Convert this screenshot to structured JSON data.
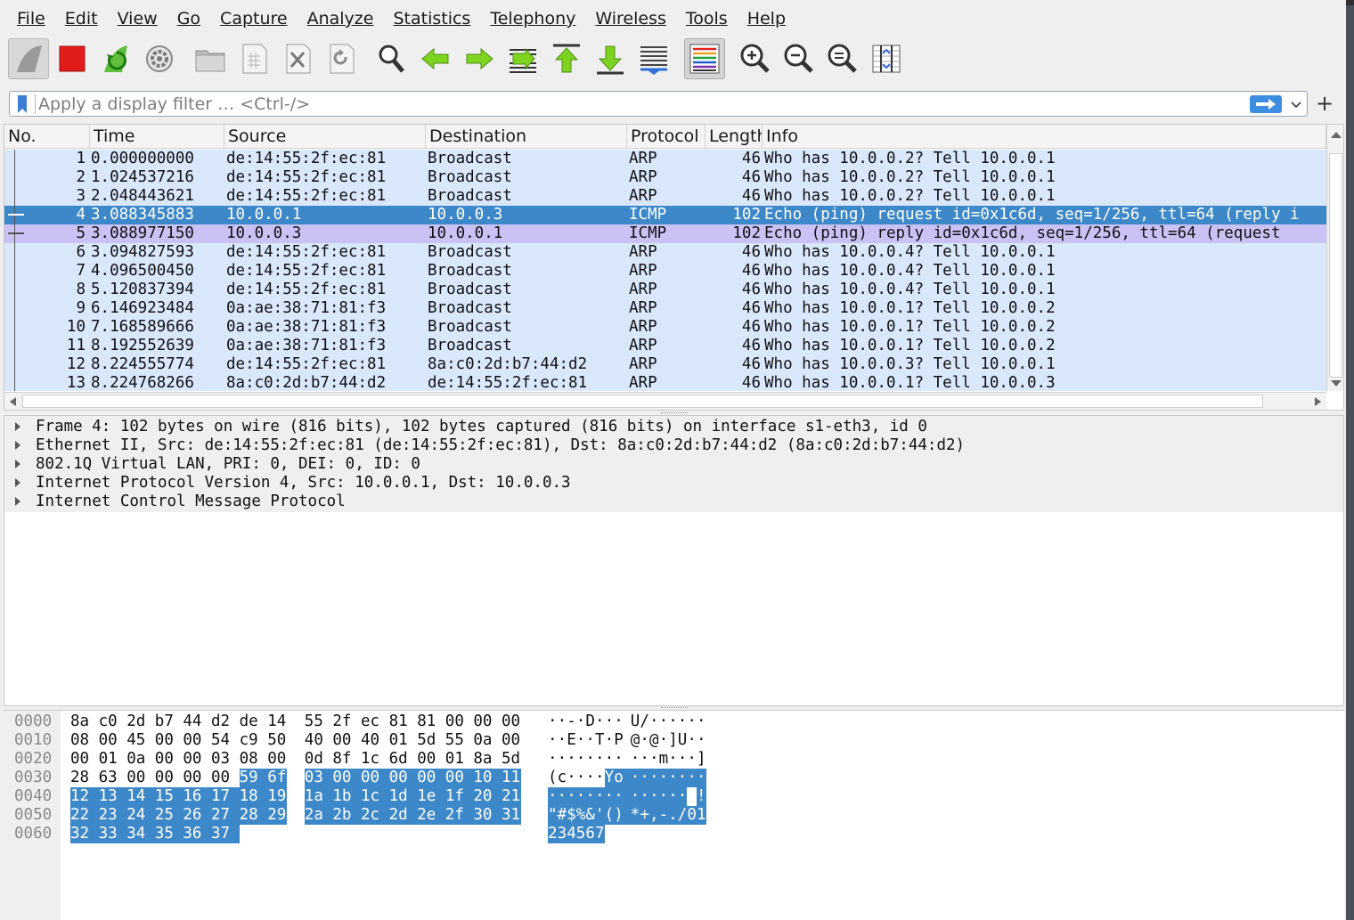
{
  "menu": [
    "File",
    "Edit",
    "View",
    "Go",
    "Capture",
    "Analyze",
    "Statistics",
    "Telephony",
    "Wireless",
    "Tools",
    "Help"
  ],
  "toolbar": [
    {
      "name": "start-capture-icon",
      "group": 0
    },
    {
      "name": "stop-capture-icon",
      "group": 0
    },
    {
      "name": "restart-capture-icon",
      "group": 0
    },
    {
      "name": "capture-options-icon",
      "group": 0
    },
    {
      "name": "open-file-icon",
      "group": 1
    },
    {
      "name": "save-file-icon",
      "group": 1
    },
    {
      "name": "close-file-icon",
      "group": 1
    },
    {
      "name": "reload-file-icon",
      "group": 1
    },
    {
      "name": "find-packet-icon",
      "group": 2
    },
    {
      "name": "go-back-icon",
      "group": 2
    },
    {
      "name": "go-forward-icon",
      "group": 2
    },
    {
      "name": "go-to-packet-icon",
      "group": 2
    },
    {
      "name": "go-first-packet-icon",
      "group": 2
    },
    {
      "name": "go-last-packet-icon",
      "group": 2
    },
    {
      "name": "auto-scroll-icon",
      "group": 2
    },
    {
      "name": "colorize-icon",
      "group": 3
    },
    {
      "name": "zoom-in-icon",
      "group": 4
    },
    {
      "name": "zoom-out-icon",
      "group": 4
    },
    {
      "name": "zoom-normal-icon",
      "group": 4
    },
    {
      "name": "resize-columns-icon",
      "group": 4
    }
  ],
  "filter": {
    "placeholder": "Apply a display filter … <Ctrl-/>",
    "plus_label": "+"
  },
  "packet_list": {
    "columns": [
      "No.",
      "Time",
      "Source",
      "Destination",
      "Protocol",
      "Length",
      "Info"
    ],
    "selected_index": 3,
    "related_index": 4,
    "rows": [
      [
        "1",
        "0.000000000",
        "de:14:55:2f:ec:81",
        "Broadcast",
        "ARP",
        "46",
        "Who has 10.0.0.2? Tell 10.0.0.1"
      ],
      [
        "2",
        "1.024537216",
        "de:14:55:2f:ec:81",
        "Broadcast",
        "ARP",
        "46",
        "Who has 10.0.0.2? Tell 10.0.0.1"
      ],
      [
        "3",
        "2.048443621",
        "de:14:55:2f:ec:81",
        "Broadcast",
        "ARP",
        "46",
        "Who has 10.0.0.2? Tell 10.0.0.1"
      ],
      [
        "4",
        "3.088345883",
        "10.0.0.1",
        "10.0.0.3",
        "ICMP",
        "102",
        "Echo (ping) request  id=0x1c6d, seq=1/256, ttl=64 (reply i"
      ],
      [
        "5",
        "3.088977150",
        "10.0.0.3",
        "10.0.0.1",
        "ICMP",
        "102",
        "Echo (ping) reply    id=0x1c6d, seq=1/256, ttl=64 (request"
      ],
      [
        "6",
        "3.094827593",
        "de:14:55:2f:ec:81",
        "Broadcast",
        "ARP",
        "46",
        "Who has 10.0.0.4? Tell 10.0.0.1"
      ],
      [
        "7",
        "4.096500450",
        "de:14:55:2f:ec:81",
        "Broadcast",
        "ARP",
        "46",
        "Who has 10.0.0.4? Tell 10.0.0.1"
      ],
      [
        "8",
        "5.120837394",
        "de:14:55:2f:ec:81",
        "Broadcast",
        "ARP",
        "46",
        "Who has 10.0.0.4? Tell 10.0.0.1"
      ],
      [
        "9",
        "6.146923484",
        "0a:ae:38:71:81:f3",
        "Broadcast",
        "ARP",
        "46",
        "Who has 10.0.0.1? Tell 10.0.0.2"
      ],
      [
        "10",
        "7.168589666",
        "0a:ae:38:71:81:f3",
        "Broadcast",
        "ARP",
        "46",
        "Who has 10.0.0.1? Tell 10.0.0.2"
      ],
      [
        "11",
        "8.192552639",
        "0a:ae:38:71:81:f3",
        "Broadcast",
        "ARP",
        "46",
        "Who has 10.0.0.1? Tell 10.0.0.2"
      ],
      [
        "12",
        "8.224555774",
        "de:14:55:2f:ec:81",
        "8a:c0:2d:b7:44:d2",
        "ARP",
        "46",
        "Who has 10.0.0.3? Tell 10.0.0.1"
      ],
      [
        "13",
        "8.224768266",
        "8a:c0:2d:b7:44:d2",
        "de:14:55:2f:ec:81",
        "ARP",
        "46",
        "Who has 10.0.0.1? Tell 10.0.0.3"
      ]
    ]
  },
  "details": [
    "Frame 4: 102 bytes on wire (816 bits), 102 bytes captured (816 bits) on interface s1-eth3, id 0",
    "Ethernet II, Src: de:14:55:2f:ec:81 (de:14:55:2f:ec:81), Dst: 8a:c0:2d:b7:44:d2 (8a:c0:2d:b7:44:d2)",
    "802.1Q Virtual LAN, PRI: 0, DEI: 0, ID: 0",
    "Internet Protocol Version 4, Src: 10.0.0.1, Dst: 10.0.0.3",
    "Internet Control Message Protocol"
  ],
  "bytes": {
    "highlight_start": 54,
    "rows": [
      {
        "offset": "0000",
        "hex": [
          "8a",
          "c0",
          "2d",
          "b7",
          "44",
          "d2",
          "de",
          "14",
          "55",
          "2f",
          "ec",
          "81",
          "81",
          "00",
          "00",
          "00"
        ],
        "ascii": [
          "·",
          "·",
          "-",
          "·",
          "D",
          "·",
          "·",
          "·",
          "U",
          "/",
          "·",
          "·",
          "·",
          "·",
          "·",
          "·"
        ]
      },
      {
        "offset": "0010",
        "hex": [
          "08",
          "00",
          "45",
          "00",
          "00",
          "54",
          "c9",
          "50",
          "40",
          "00",
          "40",
          "01",
          "5d",
          "55",
          "0a",
          "00"
        ],
        "ascii": [
          "·",
          "·",
          "E",
          "·",
          "·",
          "T",
          "·",
          "P",
          "@",
          "·",
          "@",
          "·",
          "]",
          "U",
          "·",
          "·"
        ]
      },
      {
        "offset": "0020",
        "hex": [
          "00",
          "01",
          "0a",
          "00",
          "00",
          "03",
          "08",
          "00",
          "0d",
          "8f",
          "1c",
          "6d",
          "00",
          "01",
          "8a",
          "5d"
        ],
        "ascii": [
          "·",
          "·",
          "·",
          "·",
          "·",
          "·",
          "·",
          "·",
          "·",
          "·",
          "·",
          "m",
          "·",
          "·",
          "·",
          "]"
        ]
      },
      {
        "offset": "0030",
        "hex": [
          "28",
          "63",
          "00",
          "00",
          "00",
          "00",
          "59",
          "6f",
          "03",
          "00",
          "00",
          "00",
          "00",
          "00",
          "10",
          "11"
        ],
        "ascii": [
          "(",
          "c",
          "·",
          "·",
          "·",
          "·",
          "Y",
          "o",
          "·",
          "·",
          "·",
          "·",
          "·",
          "·",
          "·",
          "·"
        ]
      },
      {
        "offset": "0040",
        "hex": [
          "12",
          "13",
          "14",
          "15",
          "16",
          "17",
          "18",
          "19",
          "1a",
          "1b",
          "1c",
          "1d",
          "1e",
          "1f",
          "20",
          "21"
        ],
        "ascii": [
          "·",
          "·",
          "·",
          "·",
          "·",
          "·",
          "·",
          "·",
          "·",
          "·",
          "·",
          "·",
          "·",
          "·",
          " ",
          "!"
        ]
      },
      {
        "offset": "0050",
        "hex": [
          "22",
          "23",
          "24",
          "25",
          "26",
          "27",
          "28",
          "29",
          "2a",
          "2b",
          "2c",
          "2d",
          "2e",
          "2f",
          "30",
          "31"
        ],
        "ascii": [
          "\"",
          "#",
          "$",
          "%",
          "&",
          "'",
          "(",
          ")",
          "*",
          "+",
          ",",
          "-",
          ".",
          "/",
          "0",
          "1"
        ]
      },
      {
        "offset": "0060",
        "hex": [
          "32",
          "33",
          "34",
          "35",
          "36",
          "37"
        ],
        "ascii": [
          "2",
          "3",
          "4",
          "5",
          "6",
          "7"
        ]
      }
    ]
  },
  "colors": {
    "row_default": "#dae8fc",
    "row_selected": "#3d88c8",
    "row_related": "#c9c2f5"
  }
}
